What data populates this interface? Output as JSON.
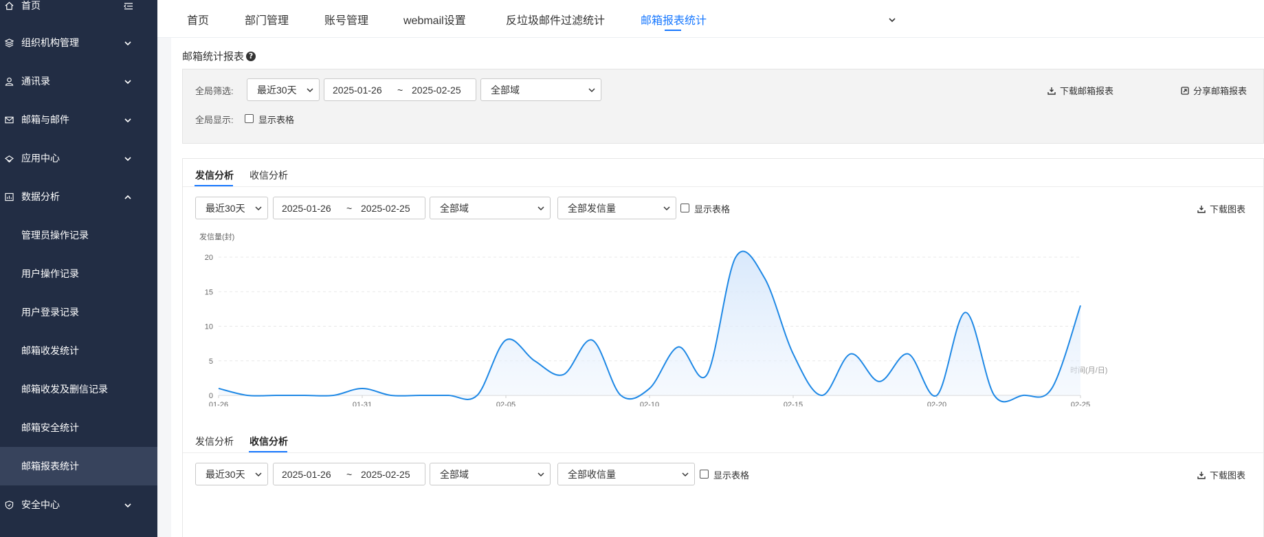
{
  "sidebar": {
    "items": [
      {
        "label": "首页",
        "icon": "home-icon"
      },
      {
        "label": "组织机构管理",
        "icon": "layers-icon"
      },
      {
        "label": "通讯录",
        "icon": "user-icon"
      },
      {
        "label": "邮箱与邮件",
        "icon": "mail-icon"
      },
      {
        "label": "应用中心",
        "icon": "app-icon"
      },
      {
        "label": "数据分析",
        "icon": "chart-icon"
      },
      {
        "label": "安全中心",
        "icon": "shield-icon"
      }
    ],
    "subitems": [
      {
        "label": "管理员操作记录"
      },
      {
        "label": "用户操作记录"
      },
      {
        "label": "用户登录记录"
      },
      {
        "label": "邮箱收发统计"
      },
      {
        "label": "邮箱收发及删信记录"
      },
      {
        "label": "邮箱安全统计"
      },
      {
        "label": "邮箱报表统计"
      }
    ]
  },
  "topnav": {
    "tabs": [
      "首页",
      "部门管理",
      "账号管理",
      "webmail设置",
      "反垃圾邮件过滤统计",
      "邮箱报表统计"
    ],
    "active_index": 5
  },
  "page": {
    "title": "邮箱统计报表"
  },
  "global_filter": {
    "label": "全局筛选:",
    "range": "最近30天",
    "date_start": "2025-01-26",
    "date_sep": "~",
    "date_end": "2025-02-25",
    "domain": "全部域",
    "download_label": "下载邮箱报表",
    "share_label": "分享邮箱报表",
    "display_label": "全局显示:",
    "show_table_label": "显示表格"
  },
  "send_section": {
    "tabs": [
      "发信分析",
      "收信分析"
    ],
    "active_index": 0,
    "range": "最近30天",
    "date_start": "2025-01-26",
    "date_sep": "~",
    "date_end": "2025-02-25",
    "domain": "全部域",
    "metric": "全部发信量",
    "show_table_label": "显示表格",
    "download_chart_label": "下载图表"
  },
  "receive_section": {
    "tabs": [
      "发信分析",
      "收信分析"
    ],
    "active_index": 1,
    "range": "最近30天",
    "date_start": "2025-01-26",
    "date_sep": "~",
    "date_end": "2025-02-25",
    "domain": "全部域",
    "metric": "全部收信量",
    "show_table_label": "显示表格",
    "download_chart_label": "下载图表"
  },
  "colors": {
    "sidebar_bg": "#222d44",
    "sidebar_active": "#37435c",
    "accent": "#1677ff",
    "line": "#1e88e5"
  },
  "chart_data": {
    "type": "area",
    "ylabel": "发信量(封)",
    "xlabel": "时间(月/日)",
    "ylim": [
      0,
      20
    ],
    "yticks": [
      0,
      5,
      10,
      15,
      20
    ],
    "xtick_labels": [
      "01-26",
      "01-31",
      "02-05",
      "02-10",
      "02-15",
      "02-20",
      "02-25"
    ],
    "grid": "horizontal dashed",
    "x": [
      "01-26",
      "01-27",
      "01-28",
      "01-29",
      "01-30",
      "01-31",
      "02-01",
      "02-02",
      "02-03",
      "02-04",
      "02-05",
      "02-06",
      "02-07",
      "02-08",
      "02-09",
      "02-10",
      "02-11",
      "02-12",
      "02-13",
      "02-14",
      "02-15",
      "02-16",
      "02-17",
      "02-18",
      "02-19",
      "02-20",
      "02-21",
      "02-22",
      "02-23",
      "02-24",
      "02-25"
    ],
    "series": [
      {
        "values": [
          1,
          0,
          0,
          0,
          0,
          1,
          0,
          0,
          0,
          0,
          8,
          5,
          3,
          8,
          0,
          1,
          7,
          3,
          20,
          17,
          6,
          0,
          6,
          2,
          6,
          0,
          12,
          0,
          0,
          1,
          13
        ]
      }
    ]
  }
}
